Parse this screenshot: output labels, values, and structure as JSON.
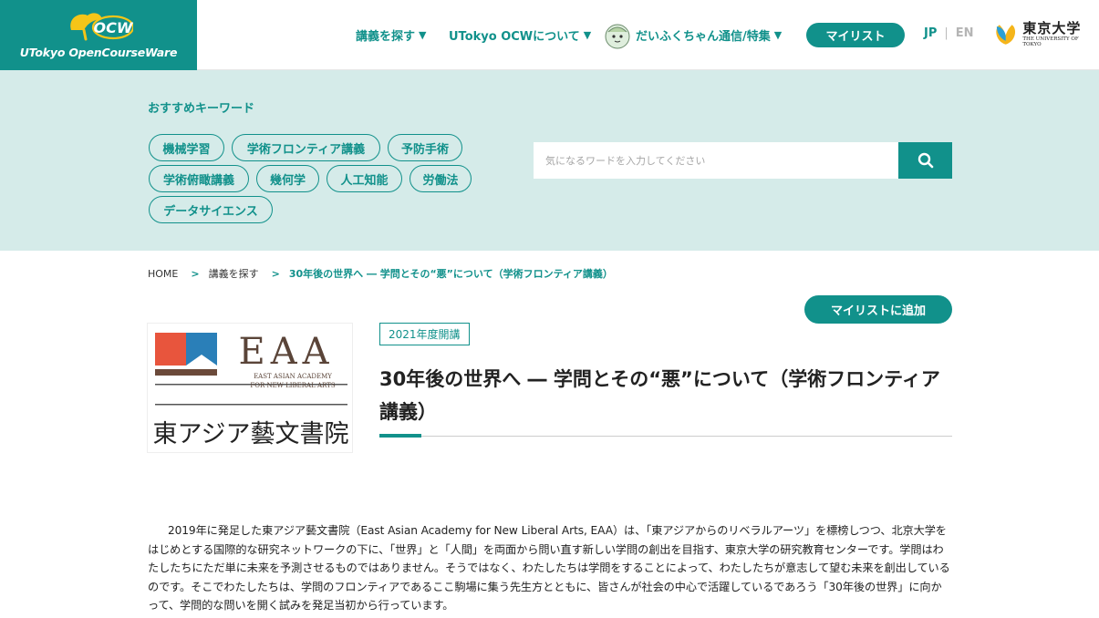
{
  "header": {
    "logo_brand": "OCW",
    "logo_text": "UTokyo OpenCourseWare",
    "nav": [
      {
        "label": "講義を探す",
        "arrow": "▼"
      },
      {
        "label": "UTokyo OCWについて",
        "arrow": "▼"
      },
      {
        "label": "だいふくちゃん通信/特集",
        "arrow": "▼"
      }
    ],
    "mylist_label": "マイリスト",
    "lang_jp": "JP",
    "lang_sep": "|",
    "lang_en": "EN",
    "utokyo_jp": "東京大学",
    "utokyo_en": "THE UNIVERSITY OF TOKYO"
  },
  "keywords": {
    "title": "おすすめキーワード",
    "tags": [
      "機械学習",
      "学術フロンティア講義",
      "予防手術",
      "学術俯瞰講義",
      "幾何学",
      "人工知能",
      "労働法",
      "データサイエンス"
    ]
  },
  "search": {
    "placeholder": "気になるワードを入力してください",
    "icon": "search-icon"
  },
  "breadcrumb": {
    "items": [
      "HOME",
      "講義を探す"
    ],
    "separator": ">",
    "current": "30年後の世界へ ― 学問とその“悪”について（学術フロンティア講義）"
  },
  "course": {
    "add_label": "マイリストに追加",
    "logo_eaa": "EAA",
    "logo_sub1": "EAST ASIAN ACADEMY",
    "logo_sub2": "FOR NEW LIBERAL ARTS",
    "logo_jp": "東アジア藝文書院",
    "year": "2021年度開講",
    "title": "30年後の世界へ ― 学問とその“悪”について（学術フロンティア講義）",
    "description": "2019年に発足した東アジア藝文書院（East Asian Academy for New Liberal Arts, EAA）は、「東アジアからのリベラルアーツ」を標榜しつつ、北京大学をはじめとする国際的な研究ネットワークの下に、「世界」と「人間」を両面から問い直す新しい学問の創出を目指す、東京大学の研究教育センターです。学問はわたしたちにただ単に未来を予測させるものではありません。そうではなく、わたしたちは学問をすることによって、わたしたちが意志して望む未来を創出しているのです。そこでわたしたちは、学問のフロンティアであるここ駒場に集う先生方とともに、皆さんが社会の中心で活躍しているであろう「30年後の世界」に向かって、学問的な問いを開く試みを発足当初から行っています。"
  },
  "colors": {
    "accent": "#11918b",
    "band": "#d5ebe9",
    "eaa_red": "#e8553d",
    "eaa_blue": "#2a7fb8",
    "eaa_brown": "#6b4a3a"
  }
}
